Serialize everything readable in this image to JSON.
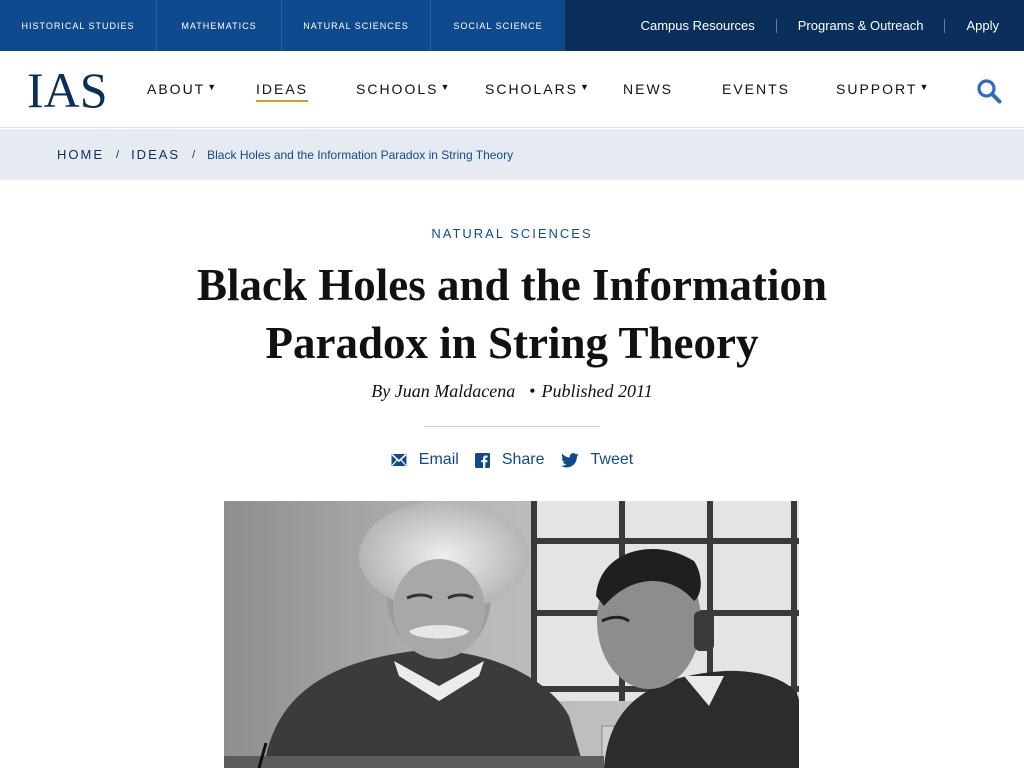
{
  "top_bar": {
    "schools": [
      "Historical Studies",
      "Mathematics",
      "Natural Sciences",
      "Social Science"
    ],
    "utility_links": [
      "Campus Resources",
      "Programs & Outreach",
      "Apply"
    ]
  },
  "nav": {
    "logo": "IAS",
    "items": [
      {
        "label": "About",
        "caret": true
      },
      {
        "label": "Ideas",
        "caret": false,
        "active": true
      },
      {
        "label": "Schools",
        "caret": true
      },
      {
        "label": "Scholars",
        "caret": true
      },
      {
        "label": "News",
        "caret": false
      },
      {
        "label": "Events",
        "caret": false
      },
      {
        "label": "Support",
        "caret": true
      }
    ],
    "search_icon": "search-icon"
  },
  "breadcrumb": {
    "home": "Home",
    "section": "Ideas",
    "current": "Black Holes and the Information Paradox in String Theory"
  },
  "article": {
    "category": "Natural Sciences",
    "title": "Black Holes and the Information Paradox in String Theory",
    "author": "By Juan Maldacena",
    "published": "Published 2011",
    "share": [
      {
        "label": "Email",
        "icon": "email-icon"
      },
      {
        "label": "Share",
        "icon": "facebook-icon"
      },
      {
        "label": "Tweet",
        "icon": "twitter-icon"
      }
    ]
  },
  "colors": {
    "brand_navy": "#0b2f5b",
    "school_bar_blue": "#104a8e",
    "link_blue": "#104a8e",
    "active_underline": "#c9a227",
    "breadcrumb_bg": "#e6ebf2"
  }
}
